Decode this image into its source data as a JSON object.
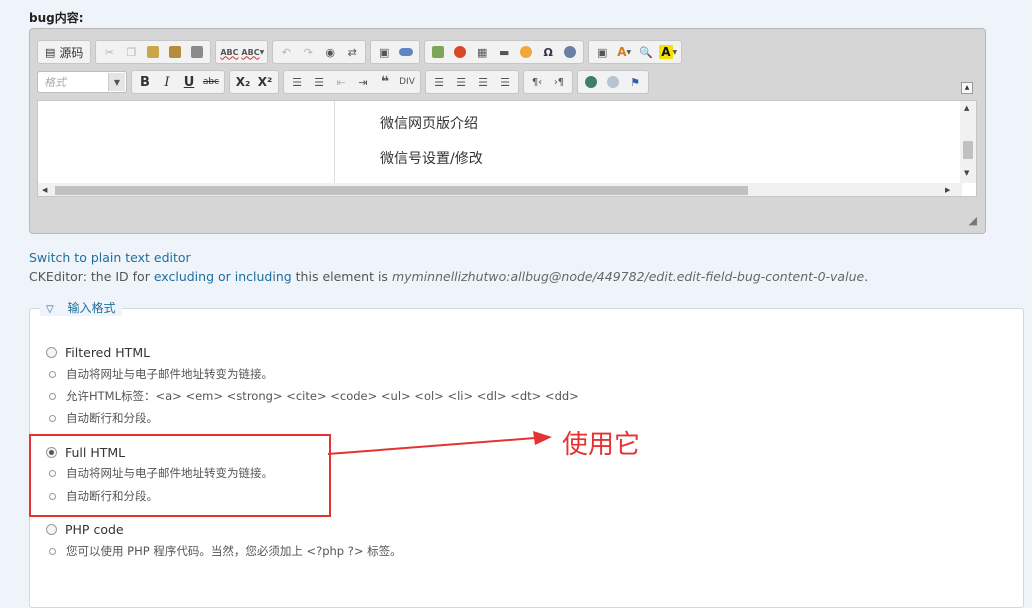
{
  "field": {
    "label": "bug内容:"
  },
  "toolbar": {
    "source_label": "源码",
    "format_placeholder": "格式",
    "spell_label": "ABC",
    "bold": "B",
    "italic": "I",
    "underline": "U",
    "strike": "abc",
    "subscript": "X₂",
    "superscript": "X²"
  },
  "editor_content": {
    "lines": [
      "微信网页版介绍",
      "微信号设置/修改"
    ]
  },
  "switch_link": "Switch to plain text editor",
  "ckeditor_note": {
    "prefix": "CKEditor: the ID for",
    "link": "excluding or including",
    "middle": "this element is",
    "id": "myminnellizhutwo:allbug@node/449782/edit.edit-field-bug-content-0-value",
    "suffix": "."
  },
  "input_format": {
    "legend": "输入格式",
    "options": [
      {
        "label": "Filtered HTML",
        "checked": false,
        "tips": [
          "自动将网址与电子邮件地址转变为链接。",
          "允许HTML标签：<a> <em> <strong> <cite> <code> <ul> <ol> <li> <dl> <dt> <dd>",
          "自动断行和分段。"
        ]
      },
      {
        "label": "Full HTML",
        "checked": true,
        "tips": [
          "自动将网址与电子邮件地址转变为链接。",
          "自动断行和分段。"
        ]
      },
      {
        "label": "PHP code",
        "checked": false,
        "tips": [
          "您可以使用 PHP 程序代码。当然，您必须加上 <?php ?> 标签。"
        ]
      }
    ]
  },
  "annotation": {
    "text": "使用它",
    "color": "#e53333"
  }
}
